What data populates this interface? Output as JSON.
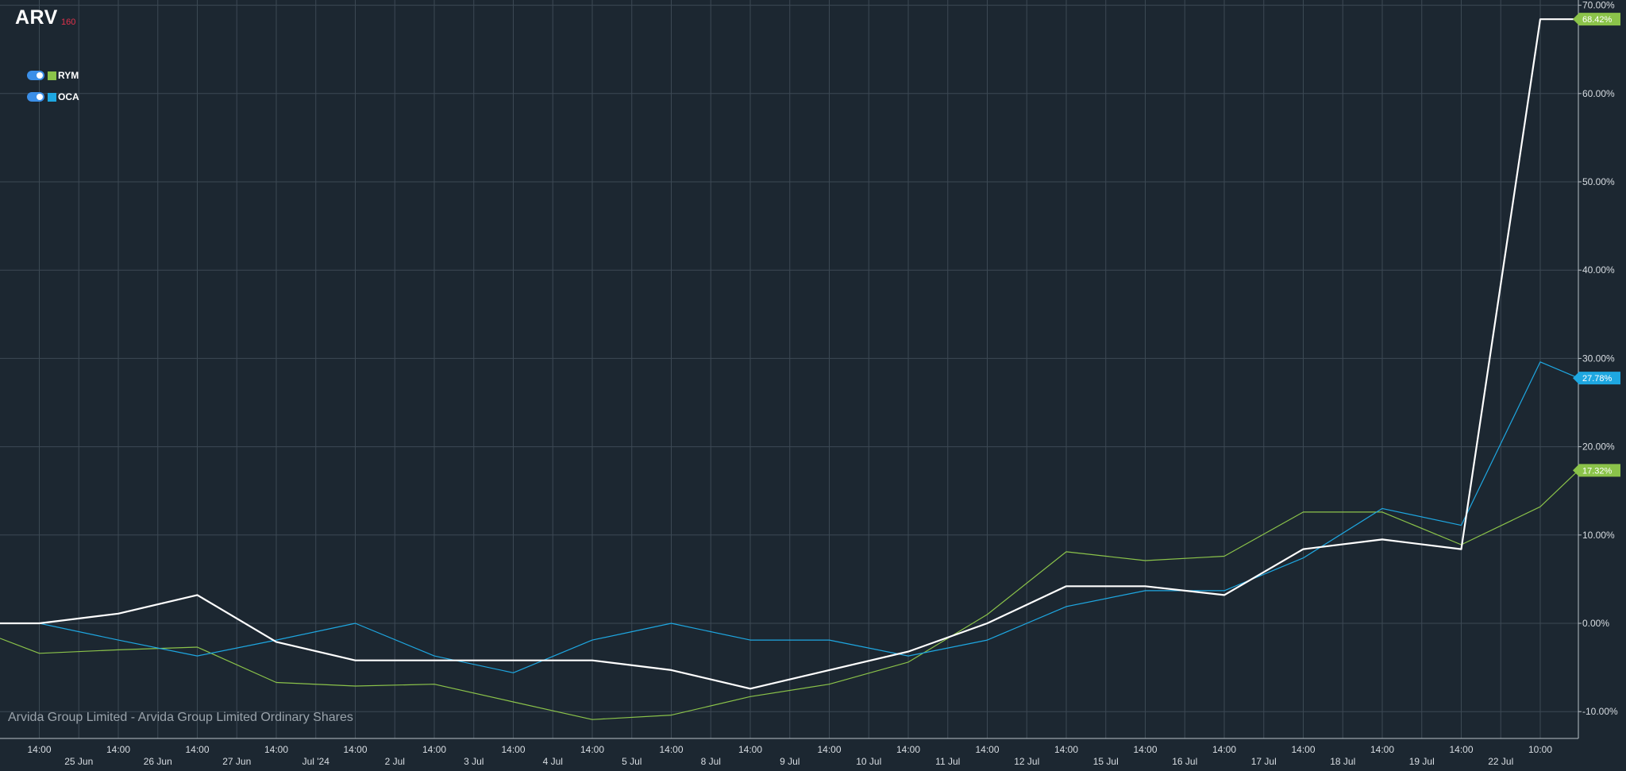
{
  "header": {
    "ticker": "ARV",
    "ticker_sub": "160"
  },
  "legend": [
    {
      "label": "RYM",
      "color": "#8bc34a"
    },
    {
      "label": "OCA",
      "color": "#1ea7e1"
    }
  ],
  "footer": {
    "company": "Arvida Group Limited - Arvida Group Limited Ordinary Shares"
  },
  "chart_data": {
    "type": "line",
    "title": "",
    "xlabel": "",
    "ylabel": "",
    "ylim": [
      -10,
      70
    ],
    "grid": true,
    "y_ticks": [
      "70.00%",
      "60.00%",
      "50.00%",
      "40.00%",
      "30.00%",
      "20.00%",
      "10.00%",
      "0.00%",
      "-10.00%"
    ],
    "x_ticks_time": [
      "14:00",
      "14:00",
      "14:00",
      "14:00",
      "14:00",
      "14:00",
      "14:00",
      "14:00",
      "14:00",
      "14:00",
      "14:00",
      "14:00",
      "14:00",
      "14:00",
      "14:00",
      "14:00",
      "14:00",
      "14:00",
      "14:00",
      "10:00"
    ],
    "x_ticks_date": [
      "25 Jun",
      "26 Jun",
      "27 Jun",
      "Jul '24",
      "2 Jul",
      "3 Jul",
      "4 Jul",
      "5 Jul",
      "8 Jul",
      "9 Jul",
      "10 Jul",
      "11 Jul",
      "12 Jul",
      "15 Jul",
      "16 Jul",
      "17 Jul",
      "18 Jul",
      "19 Jul",
      "22 Jul"
    ],
    "series": [
      {
        "name": "ARV",
        "color": "#ffffff",
        "values": [
          0,
          0,
          1.1,
          3.2,
          -2.1,
          -4.2,
          -4.2,
          -4.2,
          -4.2,
          -5.3,
          -7.4,
          -5.3,
          -3.2,
          0,
          4.2,
          4.2,
          3.2,
          8.4,
          9.5,
          8.4,
          68.42,
          68.42
        ],
        "end_label": "68.42%",
        "end_color": "#8bc34a"
      },
      {
        "name": "OCA",
        "color": "#1ea7e1",
        "values": [
          0,
          0,
          -1.9,
          -3.7,
          -1.9,
          0,
          -3.7,
          -5.6,
          -1.9,
          0,
          -1.9,
          -1.9,
          -3.7,
          -1.9,
          1.9,
          3.7,
          3.7,
          7.4,
          13.0,
          11.1,
          29.6,
          27.78
        ],
        "end_label": "27.78%",
        "end_color": "#1ea7e1"
      },
      {
        "name": "RYM",
        "color": "#8bc34a",
        "values": [
          -1.7,
          -3.4,
          -3.0,
          -2.7,
          -6.7,
          -7.1,
          -6.9,
          -8.9,
          -10.9,
          -10.4,
          -8.3,
          -6.9,
          -4.4,
          1.0,
          8.1,
          7.1,
          7.6,
          12.6,
          12.6,
          8.9,
          13.2,
          17.32
        ],
        "end_label": "17.32%",
        "end_color": "#8bc34a"
      }
    ]
  }
}
